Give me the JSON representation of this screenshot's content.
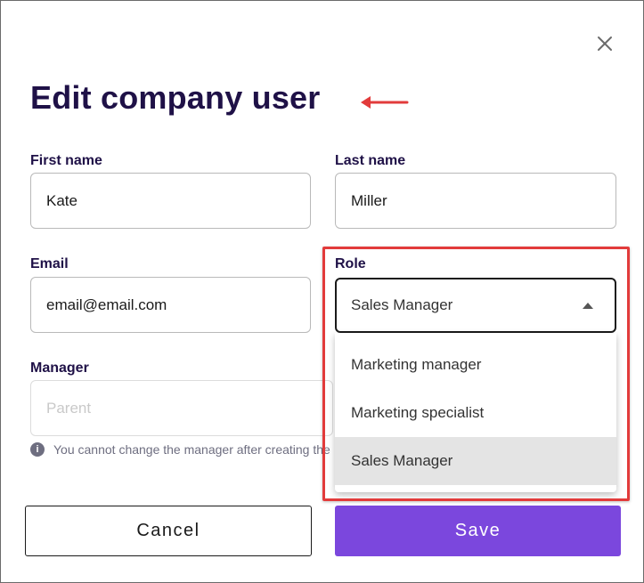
{
  "dialog": {
    "title": "Edit company user",
    "close_icon": "close-icon"
  },
  "form": {
    "first_name": {
      "label": "First name",
      "value": "Kate"
    },
    "last_name": {
      "label": "Last name",
      "value": "Miller"
    },
    "email": {
      "label": "Email",
      "value": "email@email.com"
    },
    "role": {
      "label": "Role",
      "selected": "Sales Manager",
      "options": [
        "Marketing manager",
        "Marketing specialist",
        "Sales Manager"
      ]
    },
    "manager": {
      "label": "Manager",
      "placeholder": "Parent",
      "hint": "You cannot change the manager after creating the"
    }
  },
  "buttons": {
    "cancel_label": "Cancel",
    "save_label": "Save"
  },
  "colors": {
    "title": "#1f1147",
    "primary": "#7b47dd",
    "annotation": "#e23b3b"
  }
}
